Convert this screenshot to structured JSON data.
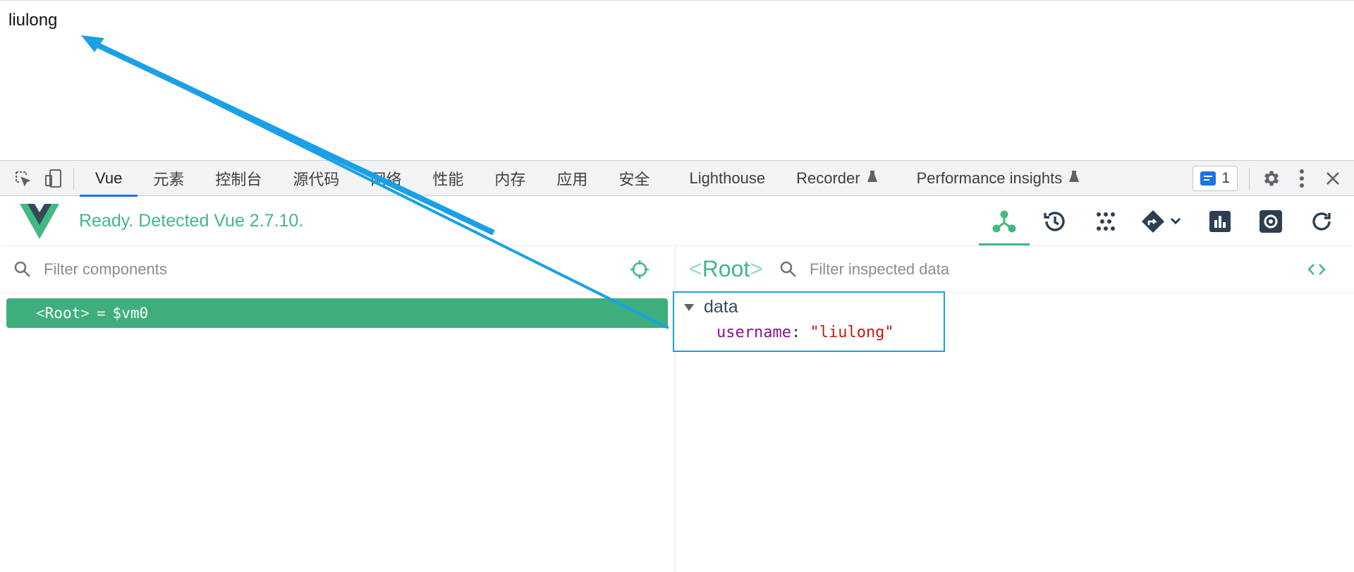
{
  "page": {
    "text": "liulong"
  },
  "devtools": {
    "tabs": [
      {
        "label": "Vue",
        "active": true
      },
      {
        "label": "元素"
      },
      {
        "label": "控制台"
      },
      {
        "label": "源代码"
      },
      {
        "label": "网络"
      },
      {
        "label": "性能"
      },
      {
        "label": "内存"
      },
      {
        "label": "应用"
      },
      {
        "label": "安全"
      },
      {
        "label": "Lighthouse"
      },
      {
        "label": "Recorder"
      },
      {
        "label": "Performance insights"
      }
    ],
    "issues_count": "1",
    "accent": "#1a73e8"
  },
  "vue": {
    "status": "Ready. Detected Vue 2.7.10.",
    "brand_color": "#42b883",
    "tools": [
      "components-icon",
      "timeline-icon",
      "plugins-icon",
      "routing-icon",
      "performance-icon",
      "settings-icon",
      "refresh-icon"
    ]
  },
  "components": {
    "filter_placeholder": "Filter components",
    "selected_row": {
      "open": "<",
      "name": "Root",
      "close": ">",
      "eq": "=",
      "vm": "$vm0"
    }
  },
  "inspector": {
    "title_open": "<",
    "title": "Root",
    "title_close": ">",
    "filter_placeholder": "Filter inspected data",
    "section": "data",
    "prop_key": "username",
    "prop_colon": ":",
    "prop_value": "\"liulong\""
  },
  "annotation": {
    "color": "#1aa0e6"
  }
}
